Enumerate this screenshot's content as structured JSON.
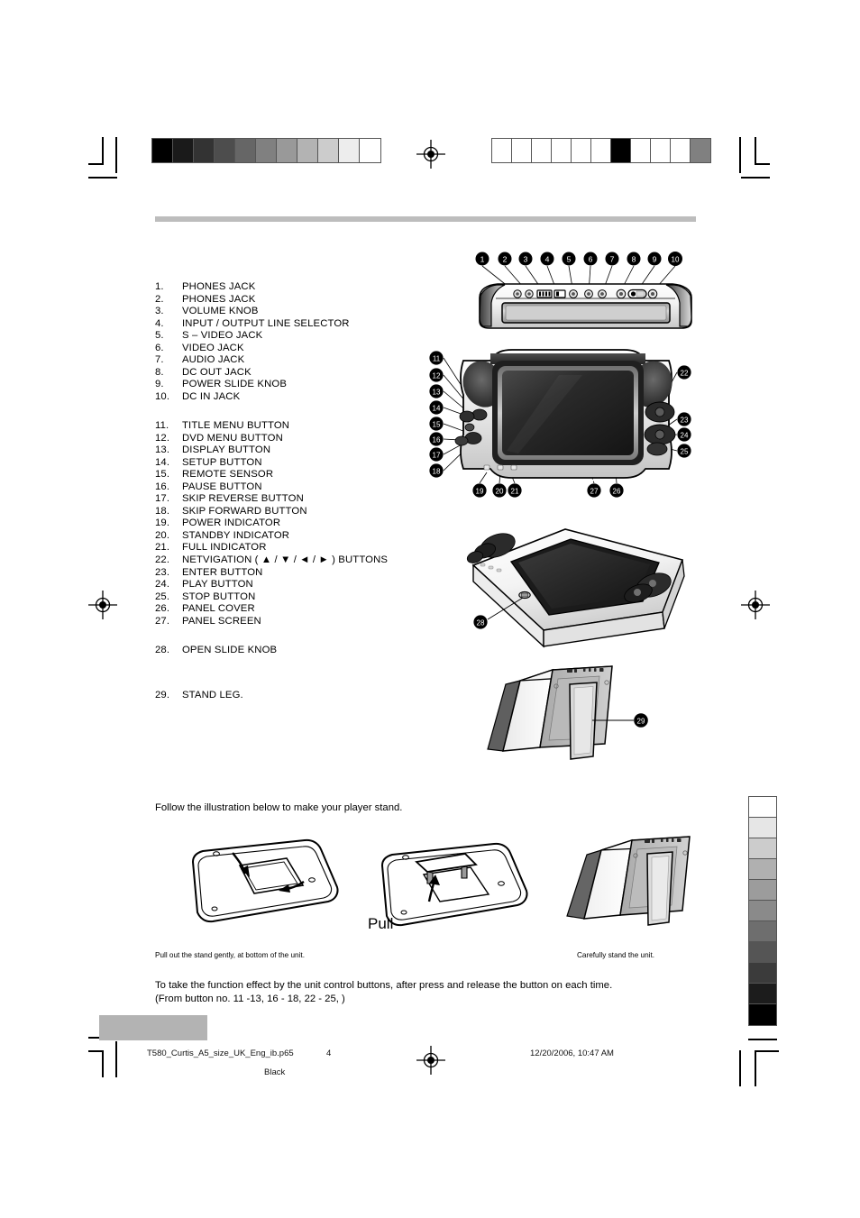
{
  "page": {
    "header_rule": true,
    "footer": {
      "filename": "T580_Curtis_A5_size_UK_Eng_ib.p65",
      "page_number": "4",
      "plate": "Black",
      "timestamp": "12/20/2006, 10:47 AM"
    }
  },
  "parts_list": {
    "group1": [
      {
        "num": "1.",
        "label": "PHONES JACK"
      },
      {
        "num": "2.",
        "label": "PHONES JACK"
      },
      {
        "num": "3.",
        "label": "VOLUME KNOB"
      },
      {
        "num": "4.",
        "label": "INPUT / OUTPUT LINE SELECTOR"
      },
      {
        "num": "5.",
        "label": "S –  VIDEO JACK"
      },
      {
        "num": "6.",
        "label": "VIDEO JACK"
      },
      {
        "num": "7.",
        "label": "AUDIO JACK"
      },
      {
        "num": "8.",
        "label": "DC OUT JACK"
      },
      {
        "num": "9.",
        "label": "POWER SLIDE KNOB"
      },
      {
        "num": "10.",
        "label": "DC IN JACK"
      }
    ],
    "group2": [
      {
        "num": "11.",
        "label": "TITLE MENU BUTTON"
      },
      {
        "num": "12.",
        "label": "DVD MENU BUTTON"
      },
      {
        "num": "13.",
        "label": "DISPLAY BUTTON"
      },
      {
        "num": "14.",
        "label": "SETUP BUTTON"
      },
      {
        "num": "15.",
        "label": "REMOTE SENSOR"
      },
      {
        "num": "16.",
        "label": "PAUSE BUTTON"
      },
      {
        "num": "17.",
        "label": "SKIP REVERSE BUTTON"
      },
      {
        "num": "18.",
        "label": "SKIP FORWARD BUTTON"
      },
      {
        "num": "19.",
        "label": "POWER INDICATOR"
      },
      {
        "num": "20.",
        "label": "STANDBY INDICATOR"
      },
      {
        "num": "21.",
        "label": "FULL INDICATOR"
      },
      {
        "num": "22.",
        "label": "NETVIGATION ( ▲ / ▼ / ◄ / ► ) BUTTONS"
      },
      {
        "num": "23.",
        "label": "ENTER BUTTON"
      },
      {
        "num": "24.",
        "label": "PLAY BUTTON"
      },
      {
        "num": "25.",
        "label": "STOP BUTTON"
      },
      {
        "num": "26.",
        "label": "PANEL COVER"
      },
      {
        "num": "27.",
        "label": "PANEL SCREEN"
      }
    ],
    "group3": [
      {
        "num": "28.",
        "label": "OPEN SLIDE KNOB"
      }
    ],
    "group4": [
      {
        "num": "29.",
        "label": "STAND LEG."
      }
    ]
  },
  "stand_section": {
    "intro": "Follow the illustration below to make your player stand.",
    "step1_caption": "Pull out the stand gently, at bottom of the unit.",
    "step2_label": "Pull",
    "step3_caption": "Carefully stand the unit.",
    "note_line1": "To take the function effect by the unit control buttons, after press and release the button on each time.",
    "note_line2": "(From button no. 11 -13, 16 - 18, 22 - 25, )"
  },
  "callouts": {
    "top_view": [
      "1",
      "2",
      "3",
      "4",
      "5",
      "6",
      "7",
      "8",
      "9",
      "10"
    ],
    "front_left": [
      "11",
      "12",
      "13",
      "14",
      "15",
      "16",
      "17",
      "18"
    ],
    "front_bottom": [
      "19",
      "20",
      "21"
    ],
    "front_screen": [
      "27",
      "26"
    ],
    "front_right": [
      "22",
      "23",
      "24",
      "25"
    ],
    "back_view": [
      "28"
    ],
    "stand_view": [
      "29"
    ]
  },
  "calibration": {
    "top_left_bar": [
      "#000000",
      "#1a1a1a",
      "#333333",
      "#4d4d4d",
      "#666666",
      "#808080",
      "#999999",
      "#b3b3b3",
      "#cccccc",
      "#ededed",
      "#ffffff"
    ],
    "top_right_bar": [
      "#ffffff",
      "#ffffff",
      "#ffffff",
      "#ffffff",
      "#ffffff",
      "#ffffff",
      "#000000",
      "#ffffff",
      "#ffffff",
      "#ffffff",
      "#808080"
    ],
    "right_vertical_bar": [
      "#ffffff",
      "#e6e6e6",
      "#cccccc",
      "#b0b0b0",
      "#9c9c9c",
      "#8a8a8a",
      "#6e6e6e",
      "#555555",
      "#3b3b3b",
      "#1c1c1c",
      "#000000"
    ]
  }
}
